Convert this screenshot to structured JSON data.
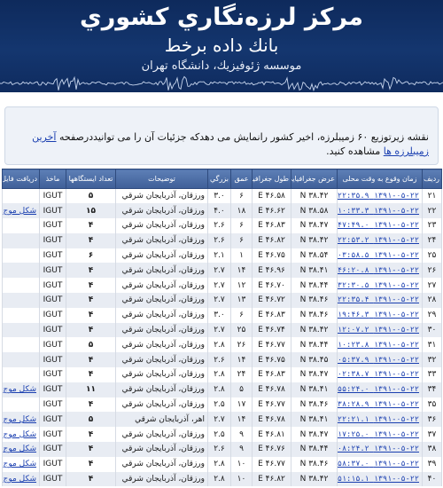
{
  "header": {
    "title": "مرکز لرزه‌نگاري کشوري",
    "subtitle": "بانك داده برخط",
    "institute": "موسسه ژئوفيزيك، دانشگاه تهران"
  },
  "notice": {
    "text_before": "نقشه زیرتوزیع ۶۰ زمیبلرزه، اخیر کشور رانمایش می دهدکه جزئیات آن را می توانیددرصفحه ",
    "link_text": "آخرین زمیبلرزه ها",
    "text_after": " مشاهده کنید."
  },
  "table": {
    "columns": [
      "رديف",
      "زمان وقوع به وقت محلی",
      "عرض جغرافيايي",
      "طول جغرافيايي",
      "عمق",
      "بزرگي",
      "توضيحات",
      "تعداد ايستگاهها",
      "ماخذ",
      "دريافت فايل"
    ],
    "rows": [
      {
        "n": "۲۱",
        "time": "۱۳۹۱-۰۵-۲۲ ۱۷:۲۲:۳۵.۹",
        "lat": "۳۸.۴۲ N",
        "lon": "۴۶.۵۸ E",
        "depth": "۶",
        "mag": "۳.۰",
        "desc": "ورزقان، آذربايجان شرقي",
        "stations": "۵",
        "src": "IGUT",
        "link": ""
      },
      {
        "n": "۲۲",
        "time": "۱۳۹۱-۰۵-۲۲ ۱۱:۱۰:۳۳.۳",
        "lat": "۳۸.۵۸ N",
        "lon": "۴۶.۶۲ E",
        "depth": "۱۸",
        "mag": "۴.۰",
        "desc": "ورزقان، آذربايجان شرقي",
        "stations": "۱۵",
        "src": "IGUT",
        "link": "شکل موج"
      },
      {
        "n": "۲۳",
        "time": "۱۳۹۱-۰۵-۲۲ ۱۰:۴۷:۴۹.۰",
        "lat": "۳۸.۴۷ N",
        "lon": "۴۶.۸۳ E",
        "depth": "۶",
        "mag": "۲.۶",
        "desc": "ورزقان، آذربايجان شرقي",
        "stations": "۴",
        "src": "IGUT",
        "link": ""
      },
      {
        "n": "۲۴",
        "time": "۱۳۹۱-۰۵-۲۲ ۱۰:۲۲:۵۳.۲",
        "lat": "۳۸.۴۲ N",
        "lon": "۴۶.۸۲ E",
        "depth": "۶",
        "mag": "۲.۶",
        "desc": "ورزقان، آذربايجان شرقي",
        "stations": "۴",
        "src": "IGUT",
        "link": ""
      },
      {
        "n": "۲۵",
        "time": "۱۳۹۱-۰۵-۲۲ ۱۰:۰۳:۵۸.۵",
        "lat": "۳۸.۵۴ N",
        "lon": "۴۶.۷۵ E",
        "depth": "۱",
        "mag": "۲.۱",
        "desc": "ورزقان، آذربايجان شرقي",
        "stations": "۶",
        "src": "IGUT",
        "link": ""
      },
      {
        "n": "۲۶",
        "time": "۱۳۹۱-۰۵-۲۲ ۰۹:۴۶:۲۰.۸",
        "lat": "۳۸.۴۱ N",
        "lon": "۴۶.۹۶ E",
        "depth": "۱۴",
        "mag": "۲.۷",
        "desc": "ورزقان، آذربايجان شرقي",
        "stations": "۴",
        "src": "IGUT",
        "link": ""
      },
      {
        "n": "۲۷",
        "time": "۱۳۹۱-۰۵-۲۲ ۰۹:۳۲:۳۰.۵",
        "lat": "۳۸.۴۴ N",
        "lon": "۴۶.۷۰ E",
        "depth": "۱۲",
        "mag": "۲.۷",
        "desc": "ورزقان، آذربايجان شرقي",
        "stations": "۴",
        "src": "IGUT",
        "link": ""
      },
      {
        "n": "۲۸",
        "time": "۱۳۹۱-۰۵-۲۲ ۰۹:۲۲:۳۵.۴",
        "lat": "۳۸.۴۶ N",
        "lon": "۴۶.۷۲ E",
        "depth": "۱۳",
        "mag": "۲.۷",
        "desc": "ورزقان، آذربايجان شرقي",
        "stations": "۴",
        "src": "IGUT",
        "link": ""
      },
      {
        "n": "۲۹",
        "time": "۱۳۹۱-۰۵-۲۲ ۰۹:۱۹:۴۶.۳",
        "lat": "۳۸.۴۶ N",
        "lon": "۴۶.۸۳ E",
        "depth": "۶",
        "mag": "۳.۰",
        "desc": "ورزقان، آذربايجان شرقي",
        "stations": "۴",
        "src": "IGUT",
        "link": ""
      },
      {
        "n": "۳۰",
        "time": "۱۳۹۱-۰۵-۲۲ ۰۹:۱۲:۰۷.۲",
        "lat": "۳۸.۴۲ N",
        "lon": "۴۶.۷۴ E",
        "depth": "۲۵",
        "mag": "۲.۷",
        "desc": "ورزقان، آذربايجان شرقي",
        "stations": "۴",
        "src": "IGUT",
        "link": ""
      },
      {
        "n": "۳۱",
        "time": "۱۳۹۱-۰۵-۲۲ ۰۹:۱۰:۲۳.۸",
        "lat": "۳۸.۴۴ N",
        "lon": "۴۶.۷۷ E",
        "depth": "۲۶",
        "mag": "۲.۸",
        "desc": "ورزقان، آذربايجان شرقي",
        "stations": "۵",
        "src": "IGUT",
        "link": ""
      },
      {
        "n": "۳۲",
        "time": "۱۳۹۱-۰۵-۲۲ ۰۹:۰۵:۳۷.۹",
        "lat": "۳۸.۴۵ N",
        "lon": "۴۶.۷۵ E",
        "depth": "۱۴",
        "mag": "۲.۶",
        "desc": "ورزقان، آذربايجان شرقي",
        "stations": "۴",
        "src": "IGUT",
        "link": ""
      },
      {
        "n": "۳۳",
        "time": "۱۳۹۱-۰۵-۲۲ ۰۹:۰۲:۳۸.۷",
        "lat": "۳۸.۴۷ N",
        "lon": "۴۶.۸۳ E",
        "depth": "۲۴",
        "mag": "۲.۸",
        "desc": "ورزقان، آذربايجان شرقي",
        "stations": "۴",
        "src": "IGUT",
        "link": ""
      },
      {
        "n": "۳۴",
        "time": "۱۳۹۱-۰۵-۲۲ ۰۸:۵۵:۲۴.۰",
        "lat": "۳۸.۴۱ N",
        "lon": "۴۶.۷۸ E",
        "depth": "۵",
        "mag": "۲.۸",
        "desc": "ورزقان، آذربايجان شرقي",
        "stations": "۱۱",
        "src": "IGUT",
        "link": "شکل موج"
      },
      {
        "n": "۳۵",
        "time": "۱۳۹۱-۰۵-۲۲ ۰۸:۳۸:۲۸.۹",
        "lat": "۳۸.۴۶ N",
        "lon": "۴۶.۷۷ E",
        "depth": "۱۷",
        "mag": "۲.۵",
        "desc": "ورزقان، آذربايجان شرقي",
        "stations": "۴",
        "src": "IGUT",
        "link": ""
      },
      {
        "n": "۳۶",
        "time": "۱۳۹۱-۰۵-۲۲ ۰۸:۲۲:۲۱.۱",
        "lat": "۳۸.۴۱ N",
        "lon": "۴۶.۷۸ E",
        "depth": "۱۴",
        "mag": "۲.۷",
        "desc": "اهر، آذربايجان شرقي",
        "stations": "۵",
        "src": "IGUT",
        "link": "شکل موج"
      },
      {
        "n": "۳۷",
        "time": "۱۳۹۱-۰۵-۲۲ ۰۸:۱۷:۲۵.۰",
        "lat": "۳۸.۴۷ N",
        "lon": "۴۶.۸۱ E",
        "depth": "۹",
        "mag": "۲.۵",
        "desc": "ورزقان، آذربايجان شرقي",
        "stations": "۴",
        "src": "IGUT",
        "link": "شکل موج"
      },
      {
        "n": "۳۸",
        "time": "۱۳۹۱-۰۵-۲۲ ۰۸:۰۸:۲۴.۲",
        "lat": "۳۸.۴۴ N",
        "lon": "۴۶.۷۶ E",
        "depth": "۹",
        "mag": "۲.۶",
        "desc": "ورزقان، آذربايجان شرقي",
        "stations": "۴",
        "src": "IGUT",
        "link": "شکل موج"
      },
      {
        "n": "۳۹",
        "time": "۱۳۹۱-۰۵-۲۲ ۰۷:۵۸:۳۷.۰",
        "lat": "۳۸.۴۶ N",
        "lon": "۴۶.۷۷ E",
        "depth": "۱۰",
        "mag": "۲.۸",
        "desc": "ورزقان، آذربايجان شرقي",
        "stations": "۴",
        "src": "IGUT",
        "link": "شکل موج"
      },
      {
        "n": "۴۰",
        "time": "۱۳۹۱-۰۵-۲۲ ۰۷:۵۱:۱۵.۱",
        "lat": "۳۸.۴۲ N",
        "lon": "۴۶.۸۲ E",
        "depth": "۱۰",
        "mag": "۲.۸",
        "desc": "ورزقان، آذربايجان شرقي",
        "stations": "۴",
        "src": "IGUT",
        "link": "شکل موج"
      }
    ]
  },
  "colors": {
    "header_bg": "#14366f",
    "table_header_bg": "#4a6aa4",
    "link": "#1a3fb0",
    "row_alt": "#e8ecf3"
  },
  "icons": [
    "seismogram-trace"
  ]
}
